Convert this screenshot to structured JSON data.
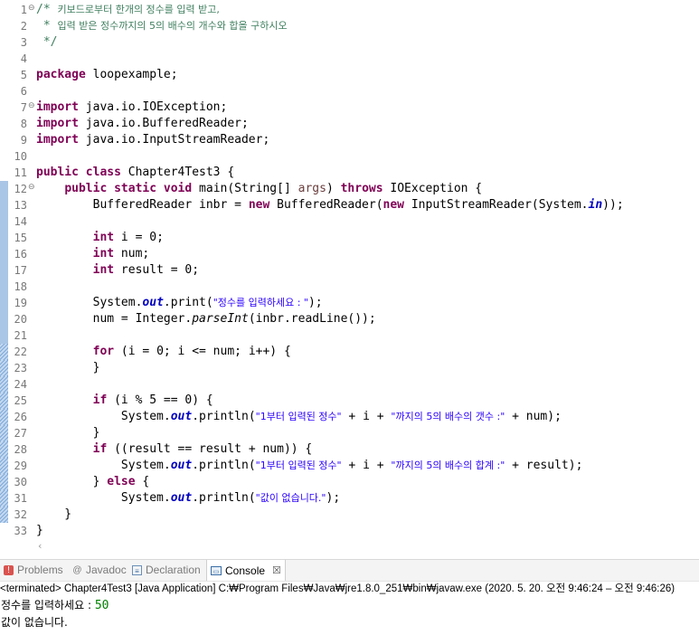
{
  "editor": {
    "line_numbers": [
      "1",
      "2",
      "3",
      "4",
      "5",
      "6",
      "7",
      "8",
      "9",
      "10",
      "11",
      "12",
      "13",
      "14",
      "15",
      "16",
      "17",
      "18",
      "19",
      "20",
      "21",
      "22",
      "23",
      "24",
      "25",
      "26",
      "27",
      "28",
      "29",
      "30",
      "31",
      "32",
      "33"
    ],
    "comment": {
      "l1_open": "/* ",
      "l1_text": "키보드로부터 한개의 정수를 입력 받고,",
      "l2_star": " * ",
      "l2_text": "입력 받은 정수까지의 5의 배수의 개수와 합을 구하시오",
      "l3": " */"
    },
    "kw": {
      "package": "package",
      "import": "import",
      "public": "public",
      "class": "class",
      "static": "static",
      "void": "void",
      "throws": "throws",
      "new": "new",
      "int": "int",
      "for": "for",
      "if": "if",
      "else": "else"
    },
    "code": {
      "package_name": " loopexample;",
      "import1": " java.io.IOException;",
      "import2": " java.io.BufferedReader;",
      "import3": " java.io.InputStreamReader;",
      "class_decl": " Chapter4Test3 {",
      "main_sig_a": " main(String[] ",
      "args": "args",
      "main_sig_b": ") ",
      "main_sig_c": " IOException {",
      "l13_a": "        BufferedReader inbr = ",
      "l13_b": " BufferedReader(",
      "l13_c": " InputStreamReader(System.",
      "in": "in",
      "l13_d": "));",
      "i_decl": " i = 0;",
      "num_decl": " num;",
      "result_decl": " result = 0;",
      "sys": "System.",
      "out": "out",
      "print_a": ".print(",
      "print_str": "\"정수를 입력하세요 : \"",
      "print_b": ");",
      "l20_a": "num = Integer.",
      "parseInt": "parseInt",
      "l20_b": "(inbr.readLine());",
      "for_a": " (i = 0; i <= num; i++) {",
      "close_brace": "}",
      "if1": " (i % 5 == 0) {",
      "println_a": ".println(",
      "str_count_1": "\"1부터 입력된 정수\"",
      "plus_i": " + i + ",
      "str_count_2": "\"까지의 5의 배수의 갯수 :\"",
      "count_tail": " + num);",
      "if2": " ((result == result + num)) {",
      "str_sum_2": "\"까지의 5의 배수의 합계 :\"",
      "sum_tail": " + result);",
      "else_open": "} ",
      "else_brace": " {",
      "str_none": "\"값이 없습니다.\"",
      "end_l32": "    }",
      "end_l33": "}"
    },
    "scroll_arrow": "‹"
  },
  "tabs": [
    {
      "label": "Problems",
      "icon": "problems-icon"
    },
    {
      "label": "Javadoc",
      "icon": "javadoc-at-icon"
    },
    {
      "label": "Declaration",
      "icon": "declaration-icon"
    },
    {
      "label": "Console",
      "icon": "console-icon",
      "active": true
    }
  ],
  "tab_close": "☒",
  "console": {
    "status": "<terminated> Chapter4Test3 [Java Application] C:₩Program Files₩Java₩jre1.8.0_251₩bin₩javaw.exe  (2020. 5. 20. 오전 9:46:24 – 오전 9:46:26)",
    "prompt": "정수를 입력하세요 : ",
    "input_value": "50",
    "output": "값이 없습니다."
  },
  "colors": {
    "keyword": "#7f0055",
    "string": "#2a00ff",
    "comment": "#3f7f5f",
    "field": "#0000c0",
    "console_input": "#008000"
  }
}
